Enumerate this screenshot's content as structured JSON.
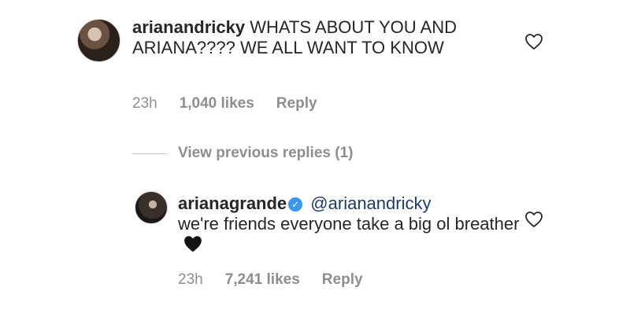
{
  "comments": [
    {
      "username": "arianandricky",
      "text": "WHATS ABOUT YOU AND ARIANA???? WE ALL WANT TO KNOW",
      "time": "23h",
      "likes": "1,040 likes",
      "reply_label": "Reply"
    },
    {
      "username": "arianagrande",
      "verified": true,
      "mention": "@arianandricky",
      "text": "we're friends everyone take a big ol breather",
      "emoji": "black-heart",
      "time": "23h",
      "likes": "7,241 likes",
      "reply_label": "Reply"
    }
  ],
  "view_previous_replies": "View previous replies (1)",
  "icons": {
    "like": "heart-outline-icon",
    "verified": "verified-badge-icon"
  },
  "colors": {
    "verified": "#3897f0",
    "meta": "#8e8e8e",
    "mention": "#1b3a6e"
  }
}
